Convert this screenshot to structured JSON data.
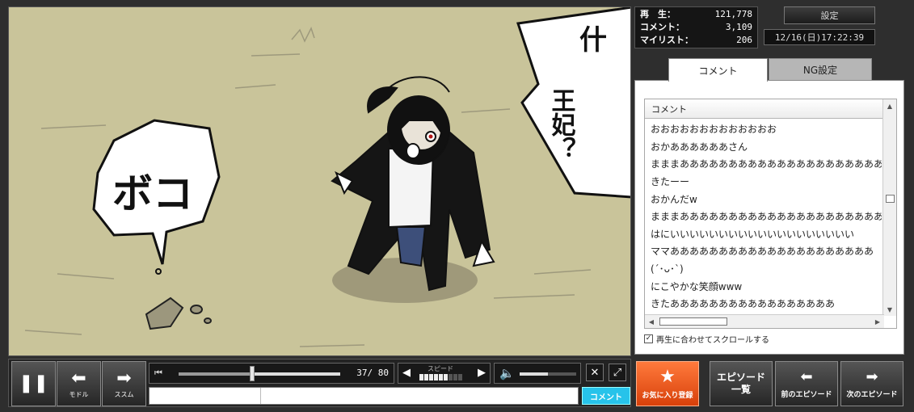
{
  "manga": {
    "bubble_left": "ボコ",
    "bubble_right_top": "什",
    "bubble_right_bottom": "王妃？"
  },
  "stats": {
    "views_label": "再　生：",
    "views": "121,778",
    "comments_label": "コメント：",
    "comments": "3,109",
    "mylist_label": "マイリスト：",
    "mylist": "206"
  },
  "header": {
    "settings_label": "設定",
    "datetime": "12/16(日)17:22:39"
  },
  "tabs": {
    "comment": "コメント",
    "ng": "NG設定"
  },
  "comment_list": {
    "header": "コメント",
    "items": [
      "おおおおおおおおおおおおお",
      "おかああああああさん",
      "まままああああああああああああああああああああああああ",
      "きたーー",
      "おかんだw",
      "まままあああああああああああああああああああああああ",
      "はにいいいいいいいいいいいいいいいいいいい",
      "ママあああああああああああああああああああああ",
      "(´･ᴗ･`)",
      "にこやかな笑顔www",
      "きたあああああああああああああああああ"
    ],
    "sync_label": "再生に合わせてスクロールする"
  },
  "controls": {
    "pause_icon": "pause-icon",
    "back_label": "モドル",
    "forward_label": "ススム",
    "page_current": "37",
    "page_total": "80",
    "page_display": "37/ 80",
    "seek_progress": 0.46,
    "speed_label": "スピード",
    "speed_level": 6,
    "speed_max": 9,
    "volume_level": 0.5,
    "comment_submit": "コメント",
    "command_placeholder": "",
    "comment_placeholder": ""
  },
  "episode": {
    "favorite_label": "お気に入り登録",
    "list_line1": "エピソード",
    "list_line2": "一覧",
    "prev_label": "前のエピソード",
    "next_label": "次のエピソード"
  }
}
